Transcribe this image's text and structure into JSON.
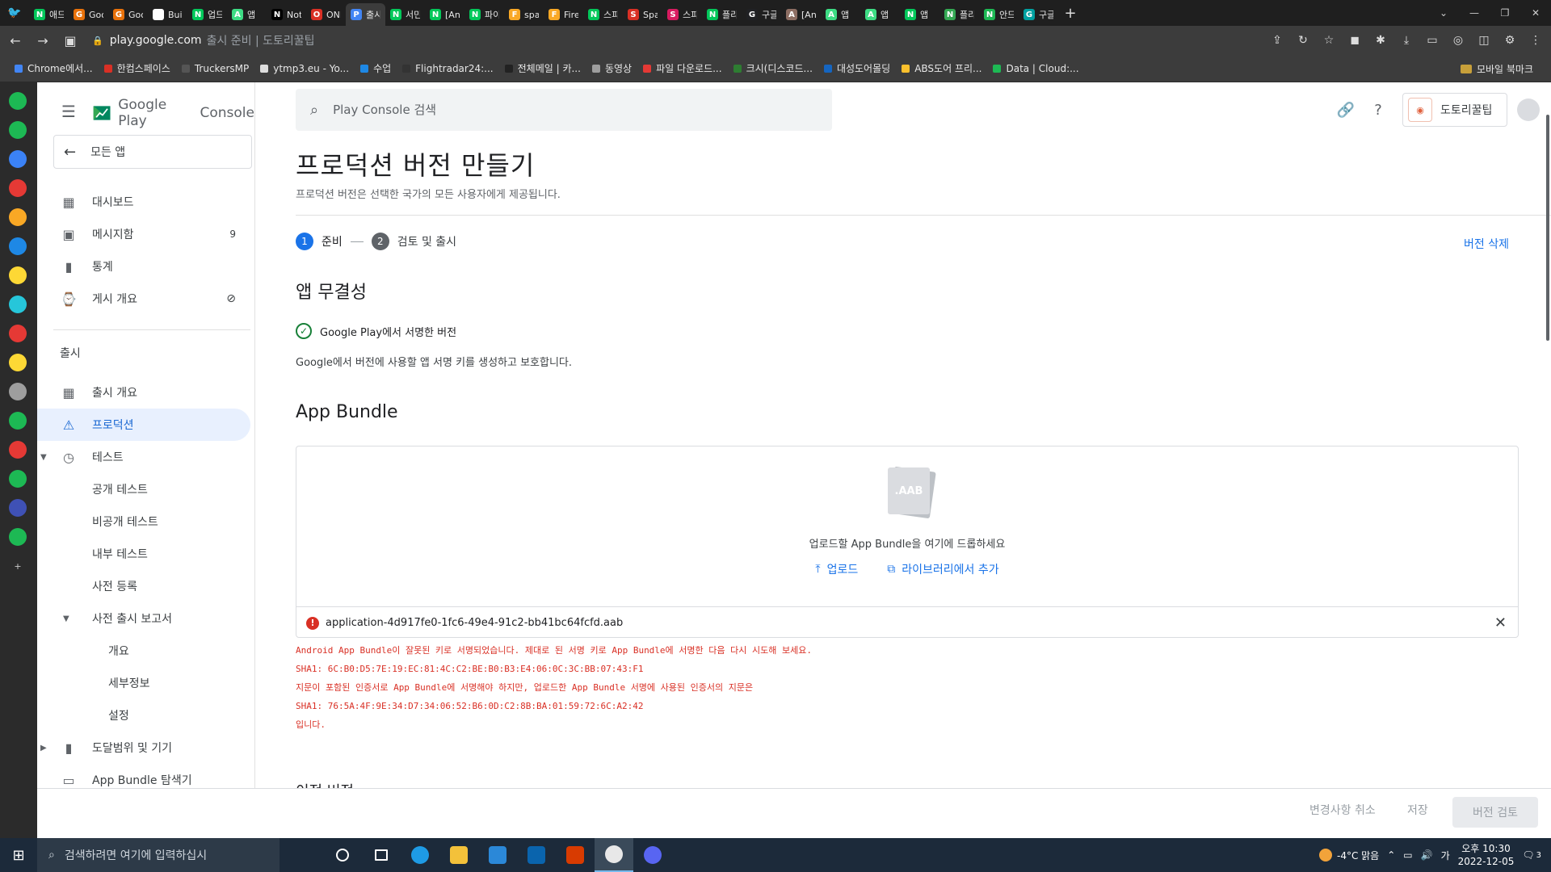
{
  "browser": {
    "tabs": [
      {
        "title": "애드",
        "color": "#03c75a",
        "glyph": "N"
      },
      {
        "title": "Goo",
        "color": "#e8710a",
        "glyph": "G"
      },
      {
        "title": "Goo",
        "color": "#e8710a",
        "glyph": "G"
      },
      {
        "title": "Buil",
        "color": "#ffffff",
        "glyph": "A"
      },
      {
        "title": "업드",
        "color": "#03c75a",
        "glyph": "N"
      },
      {
        "title": "앱 ",
        "color": "#3ddc84",
        "glyph": "A"
      },
      {
        "title": "Not",
        "color": "#000000",
        "glyph": "N"
      },
      {
        "title": "ONI",
        "color": "#d93025",
        "glyph": "O"
      },
      {
        "title": "출시",
        "color": "#4285f4",
        "glyph": "P"
      },
      {
        "title": "서민",
        "color": "#03c75a",
        "glyph": "N"
      },
      {
        "title": "[Anc",
        "color": "#03c75a",
        "glyph": "N"
      },
      {
        "title": "파이",
        "color": "#03c75a",
        "glyph": "N"
      },
      {
        "title": "spar",
        "color": "#f9a825",
        "glyph": "F"
      },
      {
        "title": "Firel",
        "color": "#f9a825",
        "glyph": "F"
      },
      {
        "title": "스피",
        "color": "#03c75a",
        "glyph": "N"
      },
      {
        "title": "Spa",
        "color": "#d93025",
        "glyph": "S"
      },
      {
        "title": "스피",
        "color": "#d81b60",
        "glyph": "S"
      },
      {
        "title": "플리",
        "color": "#03c75a",
        "glyph": "N"
      },
      {
        "title": "구글",
        "color": "#202124",
        "glyph": "G"
      },
      {
        "title": "[Anc",
        "color": "#8d6e63",
        "glyph": "A"
      },
      {
        "title": "앱 ",
        "color": "#3ddc84",
        "glyph": "A"
      },
      {
        "title": "앱 ",
        "color": "#3ddc84",
        "glyph": "A"
      },
      {
        "title": "앱 ",
        "color": "#03c75a",
        "glyph": "N"
      },
      {
        "title": "플리",
        "color": "#34a853",
        "glyph": "N"
      },
      {
        "title": "안드",
        "color": "#1db954",
        "glyph": "N"
      },
      {
        "title": "구글",
        "color": "#00a1a1",
        "glyph": "G"
      }
    ],
    "active_tab_index": 8,
    "url_host": "play.google.com",
    "url_path": "출시 준비 | 도토리꿀팁",
    "bookmarks": [
      {
        "label": "Chrome에서...",
        "color": "#4285f4"
      },
      {
        "label": "한컴스페이스",
        "color": "#d93025"
      },
      {
        "label": "TruckersMP",
        "color": "#555555"
      },
      {
        "label": "ytmp3.eu - Yo...",
        "color": "#dddddd"
      },
      {
        "label": "수업",
        "color": "#1e88e5"
      },
      {
        "label": "Flightradar24:...",
        "color": "#333333"
      },
      {
        "label": "전체메일 | 카...",
        "color": "#222222"
      },
      {
        "label": "동영상",
        "color": "#9e9e9e"
      },
      {
        "label": "파일 다운로드...",
        "color": "#e53935"
      },
      {
        "label": "크시(디스코드...",
        "color": "#2e7d32"
      },
      {
        "label": "대성도어몰딩",
        "color": "#1565c0"
      },
      {
        "label": "ABS도어 프리...",
        "color": "#fbc02d"
      },
      {
        "label": "Data | Cloud:...",
        "color": "#1db954"
      }
    ],
    "mobile_bookmarks": "모바일 북마크"
  },
  "console": {
    "brand_google_play": "Google Play",
    "brand_console": "Console",
    "all_apps": "모든 앱",
    "nav": {
      "dashboard": "대시보드",
      "inbox": "메시지함",
      "inbox_count": "9",
      "stats": "통계",
      "publishing_overview": "게시 개요",
      "section_release": "출시",
      "release_overview": "출시 개요",
      "production": "프로덕션",
      "testing": "테스트",
      "open_testing": "공개 테스트",
      "closed_testing": "비공개 테스트",
      "internal_testing": "내부 테스트",
      "pre_registration": "사전 등록",
      "pre_launch_report": "사전 출시 보고서",
      "overview": "개요",
      "details": "세부정보",
      "settings": "설정",
      "reach_devices": "도달범위 및 기기",
      "bundle_explorer": "App Bundle 탐색기"
    },
    "search_placeholder": "Play Console 검색",
    "account_name": "도토리꿀팁"
  },
  "page": {
    "title": "프로덕션 버전 만들기",
    "subtitle": "프로덕션 버전은 선택한 국가의 모든 사용자에게 제공됩니다.",
    "steps": [
      {
        "num": "1",
        "label": "준비"
      },
      {
        "num": "2",
        "label": "검토 및 출시"
      }
    ],
    "delete_version": "버전 삭제",
    "integrity_title": "앱 무결성",
    "integrity_status": "Google Play에서 서명한 버전",
    "integrity_desc": "Google에서 버전에 사용할 앱 서명 키를 생성하고 보호합니다.",
    "bundle_title": "App Bundle",
    "aab_label": ".AAB",
    "drop_text": "업로드할 App Bundle을 여기에 드롭하세요",
    "upload": "업로드",
    "add_from_library": "라이브러리에서 추가",
    "file_name": "application-4d917fe0-1fc6-49e4-91c2-bb41bc64fcfd.aab",
    "error_lines": [
      "Android App Bundle이 잘못된 키로 서명되었습니다. 제대로 된 서명 키로 App Bundle에 서명한 다음 다시 시도해 보세요.",
      "SHA1: 6C:B0:D5:7E:19:EC:81:4C:C2:BE:B0:B3:E4:06:0C:3C:BB:07:43:F1",
      "지문이 포함된 인증서로 App Bundle에 서명해야 하지만, 업로드한 App Bundle 서명에 사용된 인증서의 지문은",
      "SHA1: 76:5A:4F:9E:34:D7:34:06:52:B6:0D:C2:8B:BA:01:59:72:6C:A2:42",
      "입니다."
    ],
    "prev_versions": "이전 버전"
  },
  "actions": {
    "discard": "변경사항 취소",
    "save": "저장",
    "review": "버전 검토"
  },
  "taskbar": {
    "search_placeholder": "검색하려면 여기에 입력하십시",
    "weather": "-4°C  맑음",
    "time": "오후 10:30",
    "date": "2022-12-05",
    "notifications": "3"
  }
}
